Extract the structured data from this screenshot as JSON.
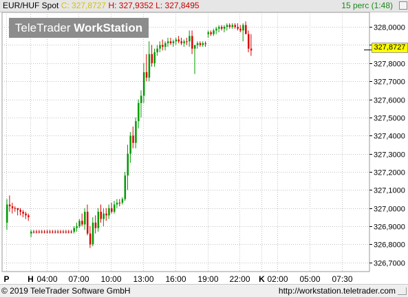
{
  "header": {
    "symbol": "EUR/HUF Spot",
    "close_label": "C: 327,8727",
    "high_label": "H: 327,9352",
    "low_label": "L: 327,8495",
    "period": "15 perc (1:48)"
  },
  "watermark": {
    "brand": "TeleTrader",
    "product": "WorkStation"
  },
  "price_tag": "327,8727",
  "footer": {
    "copyright": "© 2019 TeleTrader Software GmbH",
    "url": "http://workstation.teletrader.com"
  },
  "colors": {
    "up": "#009900",
    "down": "#dd0000",
    "doji": "#c80000",
    "grid": "#c0c0c0",
    "tag_bg": "#ffff00"
  },
  "chart_data": {
    "type": "candlestick",
    "y_axis": {
      "range": [
        326.65,
        328.08
      ],
      "ticks": [
        {
          "value": 326.7,
          "label": "326,7000"
        },
        {
          "value": 326.8,
          "label": "326,8000"
        },
        {
          "value": 326.9,
          "label": "326,9000"
        },
        {
          "value": 327.0,
          "label": "327,0000"
        },
        {
          "value": 327.1,
          "label": "327,1000"
        },
        {
          "value": 327.2,
          "label": "327,2000"
        },
        {
          "value": 327.3,
          "label": "327,3000"
        },
        {
          "value": 327.4,
          "label": "327,4000"
        },
        {
          "value": 327.5,
          "label": "327,5000"
        },
        {
          "value": 327.6,
          "label": "327,6000"
        },
        {
          "value": 327.7,
          "label": "327,7000"
        },
        {
          "value": 327.8,
          "label": "327,8000"
        },
        {
          "value": 327.9,
          "label": "327,9000"
        },
        {
          "value": 328.0,
          "label": "328,0000"
        }
      ]
    },
    "x_axis": {
      "bars": 108,
      "labels": [
        {
          "bar": 0,
          "label": "P",
          "bold": true
        },
        {
          "bar": 9,
          "label": "H",
          "bold": true
        },
        {
          "bar": 15,
          "label": "04:00"
        },
        {
          "bar": 27,
          "label": "07:00"
        },
        {
          "bar": 39,
          "label": "10:00"
        },
        {
          "bar": 51,
          "label": "13:00"
        },
        {
          "bar": 63,
          "label": "16:00"
        },
        {
          "bar": 75,
          "label": "19:00"
        },
        {
          "bar": 87,
          "label": "22:00"
        },
        {
          "bar": 95,
          "label": "K",
          "bold": true
        },
        {
          "bar": 101,
          "label": "02:00"
        },
        {
          "bar": 113,
          "label": "05:00"
        },
        {
          "bar": 125,
          "label": "07:30"
        }
      ]
    },
    "last_close": 327.8727,
    "grid": "dotted",
    "candles": [
      [
        326.92,
        327.05,
        326.88,
        327.02
      ],
      [
        327.02,
        327.07,
        326.98,
        327.01
      ],
      [
        327.01,
        327.03,
        326.97,
        327.0
      ],
      [
        327.0,
        327.01,
        326.98,
        327.0
      ],
      [
        327.0,
        327.0,
        326.96,
        326.99
      ],
      [
        326.99,
        327.0,
        326.96,
        326.98
      ],
      [
        326.98,
        326.99,
        326.95,
        326.97
      ],
      [
        326.97,
        326.98,
        326.94,
        326.96
      ],
      [
        326.96,
        326.97,
        326.93,
        326.95
      ],
      [
        326.86,
        326.88,
        326.84,
        326.87
      ],
      [
        326.87,
        326.88,
        326.86,
        326.87
      ],
      [
        326.87,
        326.88,
        326.86,
        326.87
      ],
      [
        326.87,
        326.88,
        326.86,
        326.87
      ],
      [
        326.87,
        326.88,
        326.86,
        326.87
      ],
      [
        326.87,
        326.88,
        326.86,
        326.87
      ],
      [
        326.87,
        326.88,
        326.86,
        326.87
      ],
      [
        326.87,
        326.88,
        326.86,
        326.87
      ],
      [
        326.87,
        326.88,
        326.86,
        326.87
      ],
      [
        326.87,
        326.88,
        326.86,
        326.87
      ],
      [
        326.87,
        326.88,
        326.86,
        326.87
      ],
      [
        326.87,
        326.88,
        326.86,
        326.87
      ],
      [
        326.87,
        326.88,
        326.86,
        326.87
      ],
      [
        326.87,
        326.88,
        326.86,
        326.87
      ],
      [
        326.87,
        326.88,
        326.86,
        326.87
      ],
      [
        326.87,
        326.88,
        326.86,
        326.87
      ],
      [
        326.87,
        326.9,
        326.86,
        326.89
      ],
      [
        326.89,
        326.92,
        326.87,
        326.9
      ],
      [
        326.9,
        326.94,
        326.89,
        326.93
      ],
      [
        326.93,
        326.97,
        326.9,
        326.91
      ],
      [
        326.91,
        327.0,
        326.88,
        326.98
      ],
      [
        326.98,
        327.02,
        326.85,
        326.86
      ],
      [
        326.86,
        326.9,
        326.78,
        326.8
      ],
      [
        326.8,
        326.95,
        326.79,
        326.92
      ],
      [
        326.92,
        326.96,
        326.86,
        326.89
      ],
      [
        326.89,
        327.0,
        326.87,
        326.98
      ],
      [
        326.98,
        327.02,
        326.92,
        326.94
      ],
      [
        326.94,
        327.0,
        326.9,
        326.97
      ],
      [
        326.97,
        327.0,
        326.93,
        326.96
      ],
      [
        326.96,
        327.02,
        326.94,
        327.0
      ],
      [
        327.0,
        327.03,
        326.97,
        326.98
      ],
      [
        326.98,
        327.04,
        326.97,
        327.02
      ],
      [
        327.02,
        327.05,
        327.0,
        327.03
      ],
      [
        327.03,
        327.05,
        327.01,
        327.03
      ],
      [
        327.03,
        327.06,
        327.02,
        327.05
      ],
      [
        327.05,
        327.2,
        327.04,
        327.18
      ],
      [
        327.18,
        327.35,
        327.1,
        327.3
      ],
      [
        327.3,
        327.42,
        327.25,
        327.4
      ],
      [
        327.4,
        327.45,
        327.33,
        327.36
      ],
      [
        327.36,
        327.5,
        327.33,
        327.48
      ],
      [
        327.48,
        327.6,
        327.44,
        327.58
      ],
      [
        327.58,
        327.65,
        327.5,
        327.62
      ],
      [
        327.62,
        327.8,
        327.58,
        327.75
      ],
      [
        327.75,
        327.85,
        327.7,
        327.72
      ],
      [
        327.72,
        327.92,
        327.7,
        327.85
      ],
      [
        327.85,
        327.9,
        327.78,
        327.8
      ],
      [
        327.8,
        327.88,
        327.78,
        327.86
      ],
      [
        327.86,
        327.9,
        327.84,
        327.88
      ],
      [
        327.88,
        327.92,
        327.86,
        327.9
      ],
      [
        327.9,
        327.93,
        327.87,
        327.89
      ],
      [
        327.89,
        327.92,
        327.87,
        327.91
      ],
      [
        327.91,
        327.94,
        327.89,
        327.92
      ],
      [
        327.92,
        327.94,
        327.9,
        327.91
      ],
      [
        327.91,
        327.93,
        327.89,
        327.92
      ],
      [
        327.92,
        327.94,
        327.9,
        327.93
      ],
      [
        327.93,
        327.95,
        327.91,
        327.92
      ],
      [
        327.92,
        327.94,
        327.9,
        327.91
      ],
      [
        327.91,
        327.93,
        327.89,
        327.92
      ],
      [
        327.92,
        327.94,
        327.9,
        327.92
      ],
      [
        327.92,
        327.98,
        327.89,
        327.95
      ],
      [
        327.95,
        327.98,
        327.85,
        327.88
      ],
      [
        327.88,
        327.9,
        327.74,
        327.9
      ],
      [
        327.9,
        327.92,
        327.88,
        327.91
      ],
      [
        327.91,
        327.92,
        327.89,
        327.9
      ],
      [
        327.9,
        327.92,
        327.89,
        327.91
      ],
      [
        327.91,
        327.92,
        327.89,
        327.91
      ],
      [
        327.96,
        327.98,
        327.94,
        327.97
      ],
      [
        327.97,
        327.98,
        327.95,
        327.96
      ],
      [
        327.96,
        327.99,
        327.95,
        327.98
      ],
      [
        327.98,
        328.0,
        327.96,
        327.99
      ],
      [
        327.99,
        328.01,
        327.97,
        328.0
      ],
      [
        328.0,
        328.01,
        327.98,
        327.99
      ],
      [
        327.99,
        328.01,
        327.97,
        328.0
      ],
      [
        328.0,
        328.02,
        327.98,
        328.01
      ],
      [
        328.01,
        328.02,
        327.99,
        328.0
      ],
      [
        328.0,
        328.02,
        327.99,
        328.01
      ],
      [
        328.01,
        328.02,
        327.99,
        328.0
      ],
      [
        328.0,
        328.02,
        327.98,
        327.99
      ],
      [
        327.99,
        328.01,
        327.97,
        327.98
      ],
      [
        327.98,
        328.02,
        327.92,
        328.01
      ],
      [
        328.01,
        328.03,
        327.98,
        327.96
      ],
      [
        327.96,
        327.98,
        327.86,
        327.88
      ],
      [
        327.88,
        327.96,
        327.84,
        327.87
      ]
    ]
  }
}
